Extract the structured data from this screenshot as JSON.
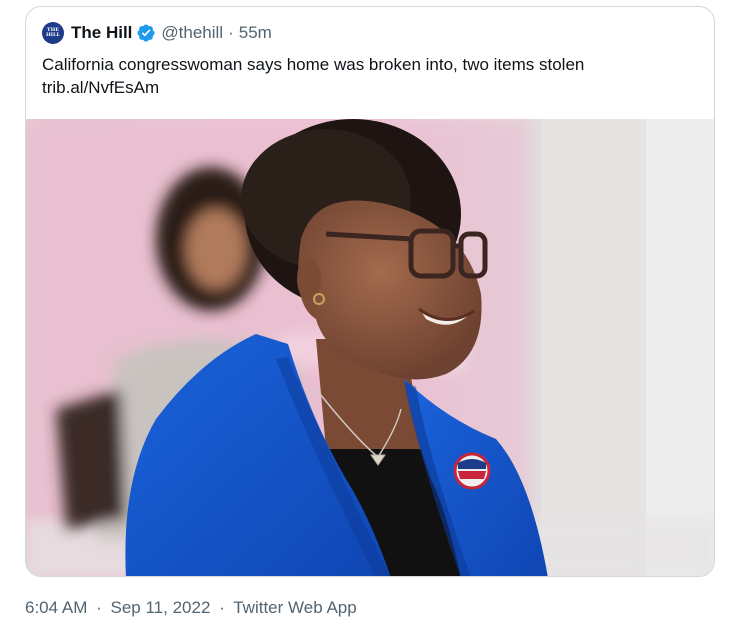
{
  "quoted_tweet": {
    "avatar_text_line1": "THE",
    "avatar_text_line2": "HILL",
    "display_name": "The Hill",
    "handle": "@thehill",
    "separator": "·",
    "time_ago": "55m",
    "text_line1": "California congresswoman says home was broken into, two items stolen",
    "text_line2": "trib.al/NvfEsAm",
    "photo_icon": "photo-image",
    "verified_icon": "verified-badge-icon"
  },
  "meta": {
    "time": "6:04 AM",
    "separator": "·",
    "date": "Sep 11, 2022",
    "source": "Twitter Web App"
  },
  "colors": {
    "verified": "#1d9bf0",
    "jacket": "#1456c8",
    "secondary_text": "#536471",
    "border": "#cfd9de"
  }
}
